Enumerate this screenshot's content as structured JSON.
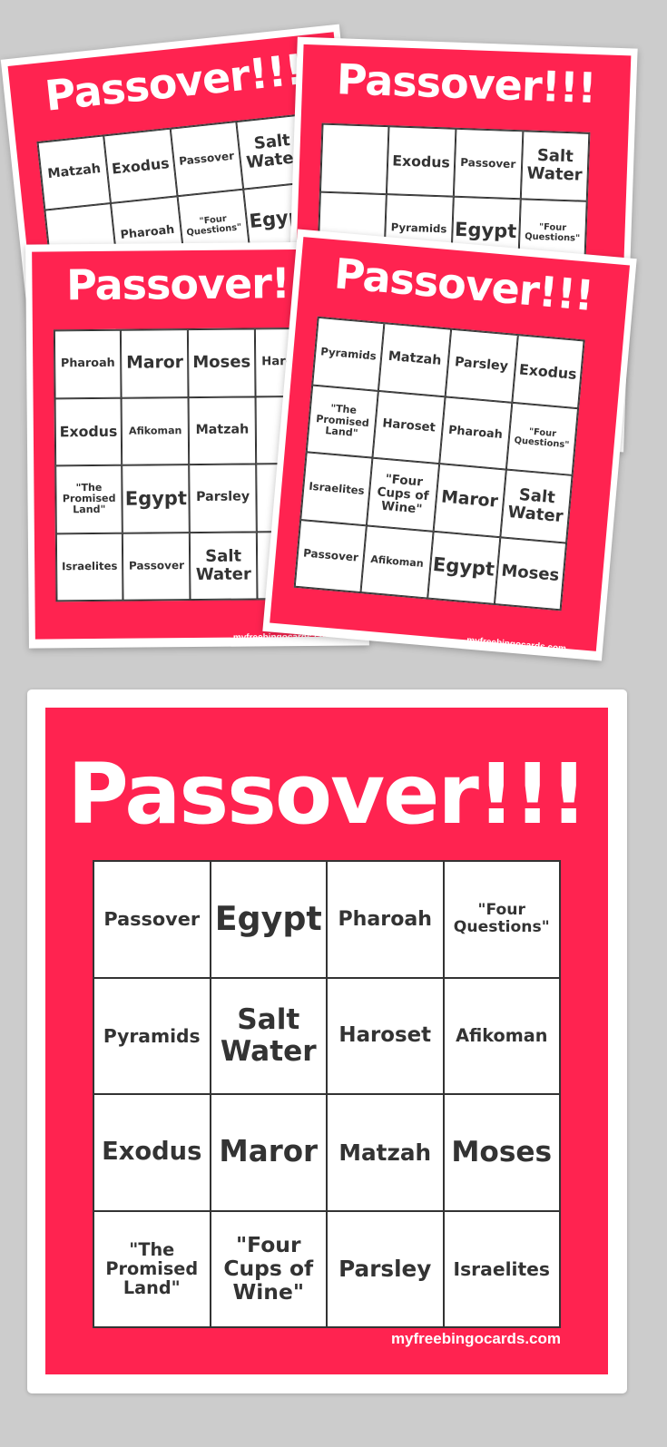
{
  "colors": {
    "background": "#cccccc",
    "card_red": "#ff2350",
    "text": "#333333"
  },
  "preview_cards": [
    {
      "title": "Passover!!!",
      "cells": [
        "Matzah",
        "Exodus",
        "Passover",
        "Salt Water",
        "",
        "Pharoah",
        "\"Four Questions\"",
        "Egypt",
        "",
        "",
        "",
        "",
        "",
        "",
        "",
        ""
      ],
      "footer": ""
    },
    {
      "title": "Passover!!!",
      "cells": [
        "",
        "Exodus",
        "Passover",
        "Salt Water",
        "",
        "Pyramids",
        "Egypt",
        "\"Four Questions\"",
        "",
        "",
        "",
        "",
        "",
        "",
        "",
        ""
      ],
      "footer": ""
    },
    {
      "title": "Passover!!!",
      "cells": [
        "Pharoah",
        "Maror",
        "Moses",
        "Haroset",
        "Exodus",
        "Afikoman",
        "Matzah",
        "",
        "\"The Promised Land\"",
        "Egypt",
        "Parsley",
        "",
        "Israelites",
        "Passover",
        "Salt Water",
        ""
      ],
      "footer": "myfreebingocards.com"
    },
    {
      "title": "Passover!!!",
      "cells": [
        "Pyramids",
        "Matzah",
        "Parsley",
        "Exodus",
        "\"The Promised Land\"",
        "Haroset",
        "Pharoah",
        "\"Four Questions\"",
        "Israelites",
        "\"Four Cups of Wine\"",
        "Maror",
        "Salt Water",
        "Passover",
        "Afikoman",
        "Egypt",
        "Moses"
      ],
      "footer": "myfreebingocards.com"
    }
  ],
  "main_card": {
    "title": "Passover!!!",
    "cells": [
      "Passover",
      "Egypt",
      "Pharoah",
      "\"Four Questions\"",
      "Pyramids",
      "Salt Water",
      "Haroset",
      "Afikoman",
      "Exodus",
      "Maror",
      "Matzah",
      "Moses",
      "\"The Promised Land\"",
      "\"Four Cups of Wine\"",
      "Parsley",
      "Israelites"
    ],
    "footer": "myfreebingocards.com"
  }
}
